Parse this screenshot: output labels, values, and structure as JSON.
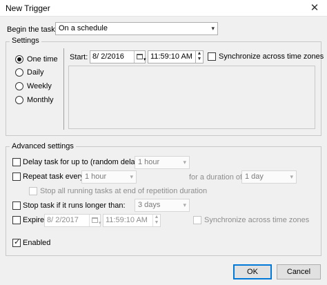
{
  "window": {
    "title": "New Trigger",
    "close_glyph": "✕"
  },
  "begin": {
    "label": "Begin the task:",
    "value": "On a schedule"
  },
  "settings": {
    "group_title": "Settings",
    "radios": [
      {
        "label": "One time",
        "checked": true
      },
      {
        "label": "Daily",
        "checked": false
      },
      {
        "label": "Weekly",
        "checked": false
      },
      {
        "label": "Monthly",
        "checked": false
      }
    ],
    "start_label": "Start:",
    "start_date": "8/  2/2016",
    "start_time": "11:59:10 AM",
    "sync_label": "Synchronize across time zones"
  },
  "advanced": {
    "group_title": "Advanced settings",
    "delay_label": "Delay task for up to (random delay):",
    "delay_value": "1 hour",
    "repeat_label": "Repeat task every:",
    "repeat_value": "1 hour",
    "duration_label": "for a duration of:",
    "duration_value": "1 day",
    "stop_all_label": "Stop all running tasks at end of repetition duration",
    "stop_if_label": "Stop task if it runs longer than:",
    "stop_if_value": "3 days",
    "expire_label": "Expire:",
    "expire_date": "8/  2/2017",
    "expire_time": "11:59:10 AM",
    "expire_sync_label": "Synchronize across time zones",
    "enabled_label": "Enabled"
  },
  "buttons": {
    "ok": "OK",
    "cancel": "Cancel"
  },
  "icons": {
    "dropdown": "▾",
    "spin_up": "▲",
    "spin_down": "▼"
  }
}
